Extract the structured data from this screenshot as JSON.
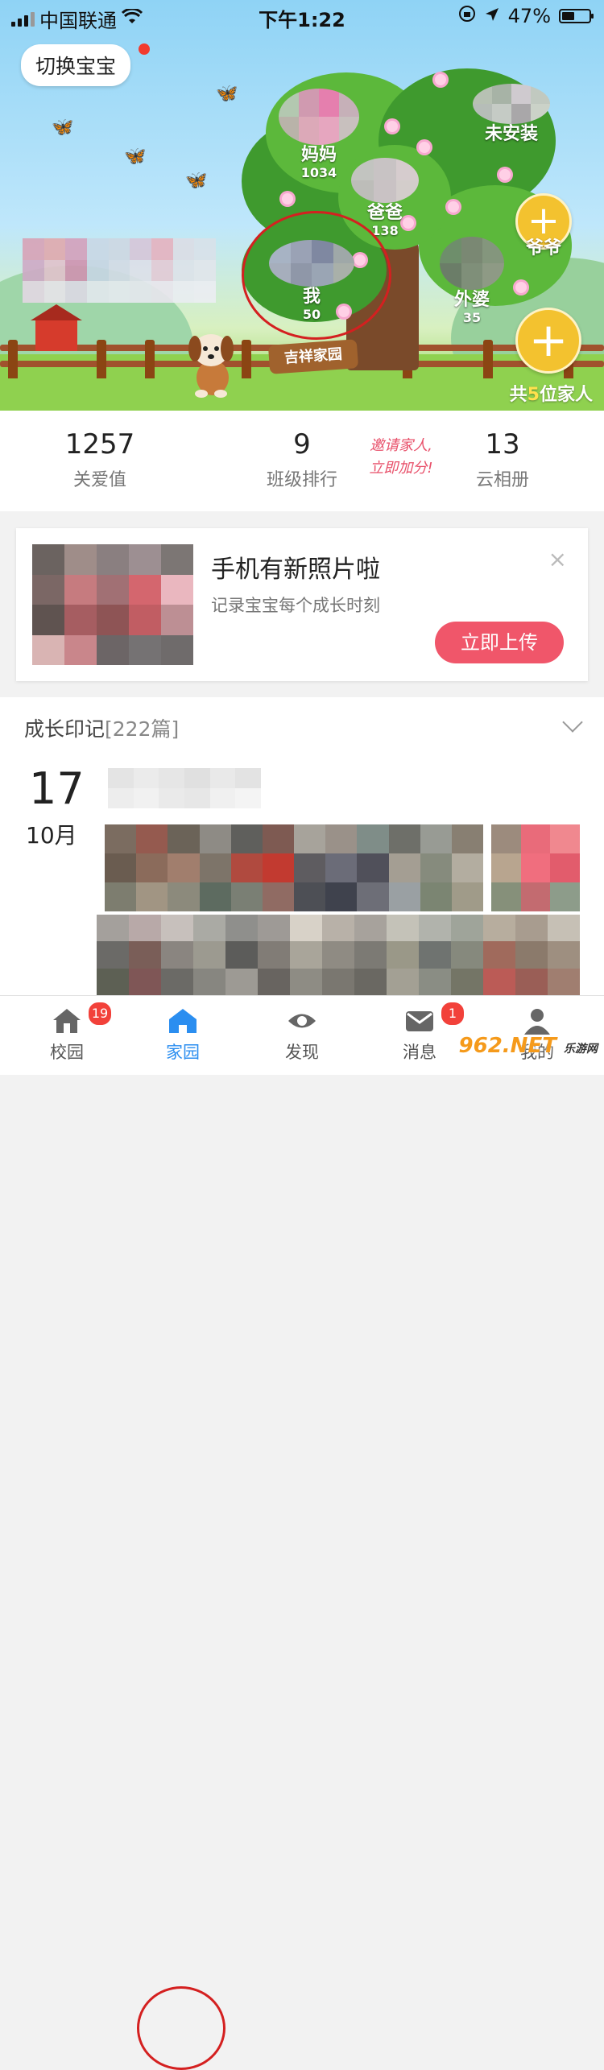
{
  "status_bar": {
    "carrier": "中国联通",
    "time": "下午1:22",
    "battery": "47%",
    "battery_level": 0.47
  },
  "hero": {
    "switch_label": "切换宝宝",
    "sign_text": "吉祥家园",
    "members": [
      {
        "name": "妈妈",
        "score": "1034"
      },
      {
        "name": "未安装",
        "score": ""
      },
      {
        "name": "爸爸",
        "score": "138"
      },
      {
        "name": "我",
        "score": "50"
      },
      {
        "name": "外婆",
        "score": "35"
      }
    ],
    "add_member_label": "爷爷",
    "family_prefix": "共",
    "family_count": "5",
    "family_suffix": "位家人"
  },
  "stats": [
    {
      "value": "1257",
      "label": "关爱值"
    },
    {
      "value": "9",
      "label": "班级排行"
    },
    {
      "value": "13",
      "label": "云相册"
    }
  ],
  "invite": {
    "line1": "邀请家人,",
    "line2": "立即加分!"
  },
  "photo_card": {
    "title": "手机有新照片啦",
    "subtitle": "记录宝宝每个成长时刻",
    "close": "×",
    "upload_label": "立即上传"
  },
  "growth": {
    "title": "成长印记",
    "count": "[222篇]",
    "day": "17",
    "month": "10月"
  },
  "tabbar": {
    "tabs": [
      {
        "label": "校园",
        "badge": "19"
      },
      {
        "label": "家园",
        "badge": ""
      },
      {
        "label": "发现",
        "badge": ""
      },
      {
        "label": "消息",
        "badge": "1"
      },
      {
        "label": "我的",
        "badge": ""
      }
    ]
  },
  "watermark": {
    "main": "962.NET",
    "sub": "乐游网"
  },
  "colors": {
    "accent_blue": "#2b8ef0",
    "upload_red": "#f0566a",
    "tree_gold": "#f3c22f",
    "badge_red": "#f2413a"
  }
}
